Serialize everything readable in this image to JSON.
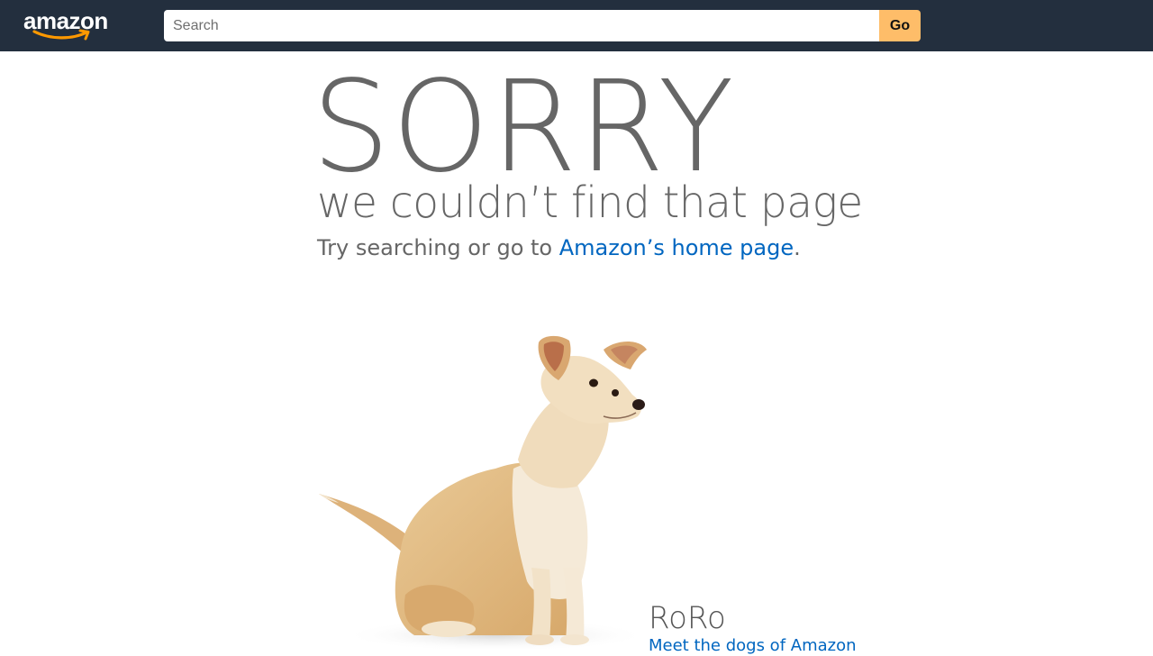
{
  "header": {
    "logo_text": "amazon",
    "background_color": "#232f3e",
    "search": {
      "placeholder": "Search",
      "value": "",
      "go_label": "Go",
      "button_color": "#febd69"
    }
  },
  "main": {
    "headline": "SORRY",
    "subheadline": "we couldn’t find that page",
    "try_text": "Try searching or go to ",
    "home_link_label": "Amazon’s home page",
    "try_suffix": ".",
    "text_color": "#666666",
    "link_color": "#0066c0"
  },
  "dog": {
    "name": "RoRo",
    "link_label": "Meet the dogs of Amazon"
  }
}
